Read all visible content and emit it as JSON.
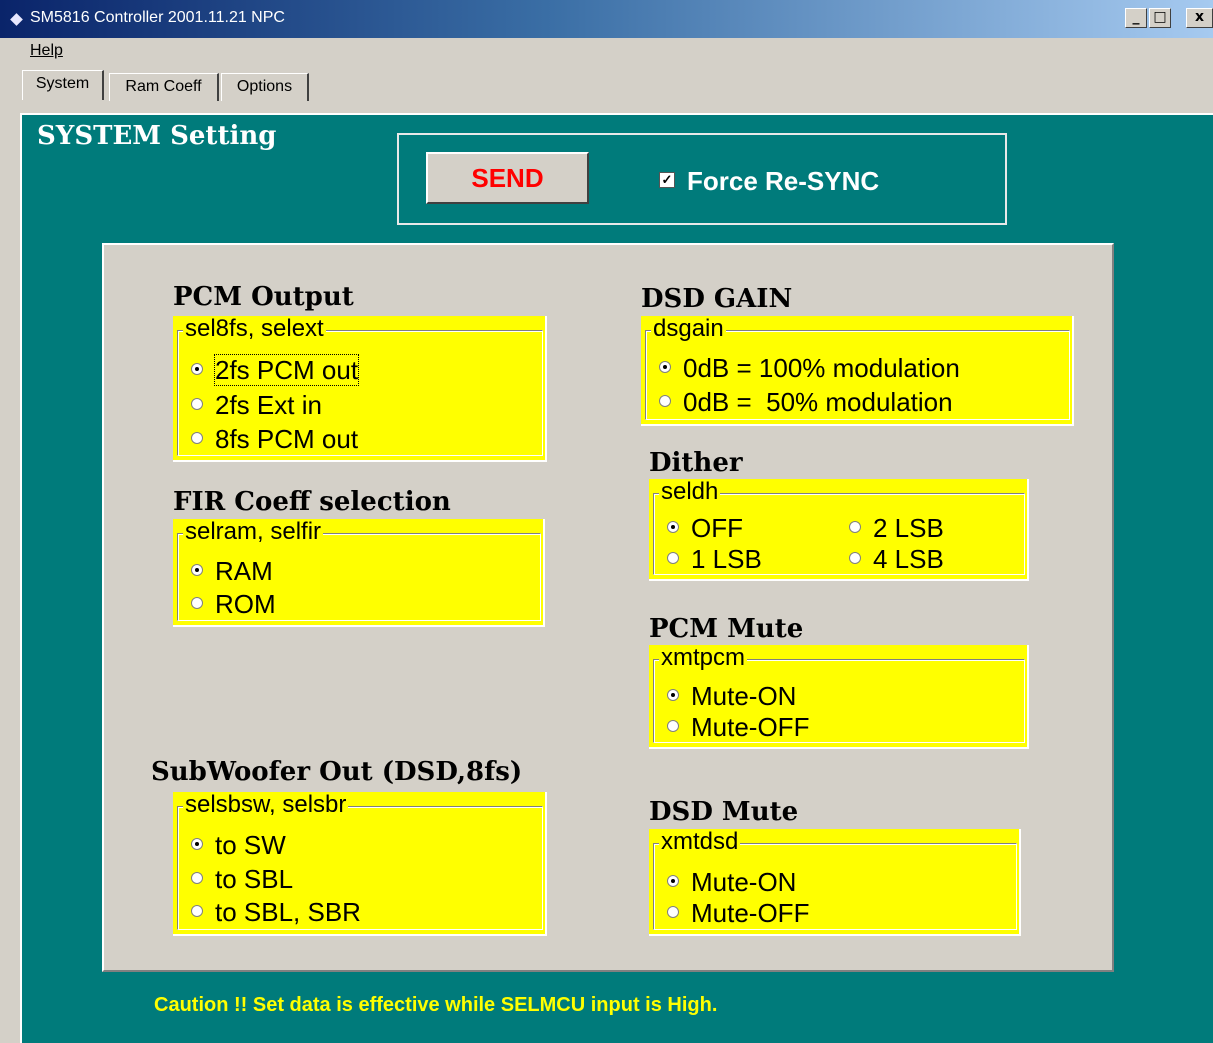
{
  "window": {
    "title": "SM5816 Controller 2001.11.21   NPC",
    "buttons": {
      "minimize": "_",
      "maximize": "□",
      "close": "x"
    }
  },
  "menu": {
    "help": "Help"
  },
  "tabs": [
    {
      "label": "System",
      "active": true
    },
    {
      "label": "Ram Coeff",
      "active": false
    },
    {
      "label": "Options",
      "active": false
    }
  ],
  "system": {
    "title": "SYSTEM Setting",
    "send_label": "SEND",
    "force_resync": {
      "label": "Force Re-SYNC",
      "checked": true
    }
  },
  "pcm_output": {
    "title": "PCM Output",
    "group": "sel8fs, selext",
    "options": [
      "2fs PCM out",
      "2fs Ext in",
      "8fs PCM out"
    ],
    "selected": 0
  },
  "fir": {
    "title": "FIR Coeff selection",
    "group": "selram, selfir",
    "options": [
      "RAM",
      "ROM"
    ],
    "selected": 0
  },
  "subwoofer": {
    "title": "SubWoofer Out (DSD,8fs)",
    "group": "selsbsw, selsbr",
    "options": [
      "to SW",
      "to SBL",
      "to SBL, SBR"
    ],
    "selected": 0
  },
  "dsd_gain": {
    "title": "DSD GAIN",
    "group": "dsgain",
    "options": [
      "0dB = 100% modulation",
      "0dB =  50% modulation"
    ],
    "selected": 0
  },
  "dither": {
    "title": "Dither",
    "group": "seldh",
    "options": [
      "OFF",
      "2 LSB",
      "1 LSB",
      "4 LSB"
    ],
    "selected": 0
  },
  "pcm_mute": {
    "title": "PCM Mute",
    "group": "xmtpcm",
    "options": [
      "Mute-ON",
      "Mute-OFF"
    ],
    "selected": 0
  },
  "dsd_mute": {
    "title": "DSD Mute",
    "group": "xmtdsd",
    "options": [
      "Mute-ON",
      "Mute-OFF"
    ],
    "selected": 0
  },
  "caution": "Caution !! Set data is effective while SELMCU input is High.",
  "colors": {
    "teal": "#007b7b",
    "yellow": "#ffff00",
    "send_text": "#ff0000",
    "caution_text": "#ffff00"
  }
}
